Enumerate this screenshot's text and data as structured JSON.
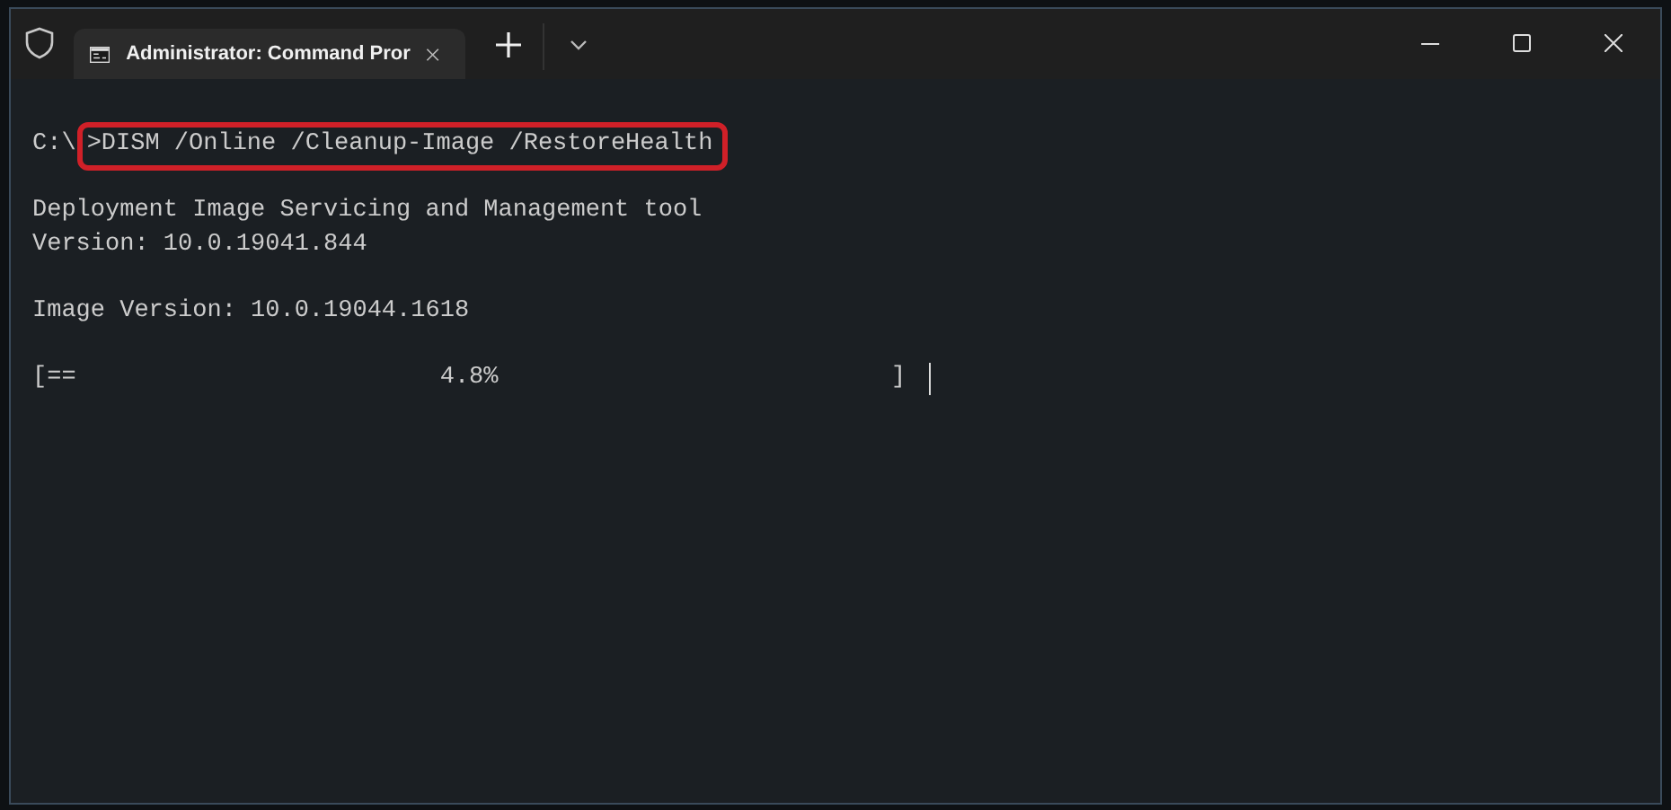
{
  "window": {
    "title": "Administrator: Command Pror"
  },
  "terminal": {
    "lines": [
      {
        "kind": "command",
        "prompt": "C:\\",
        "text": ">DISM /Online /Cleanup-Image /RestoreHealth",
        "highlighted": true
      },
      {
        "kind": "blank"
      },
      {
        "kind": "output",
        "text": "Deployment Image Servicing and Management tool"
      },
      {
        "kind": "output",
        "text": "Version: 10.0.19041.844"
      },
      {
        "kind": "blank"
      },
      {
        "kind": "output",
        "text": "Image Version: 10.0.19044.1618"
      },
      {
        "kind": "blank"
      },
      {
        "kind": "progress",
        "text": "[==                         4.8%                           ]",
        "cursor": true
      }
    ]
  }
}
